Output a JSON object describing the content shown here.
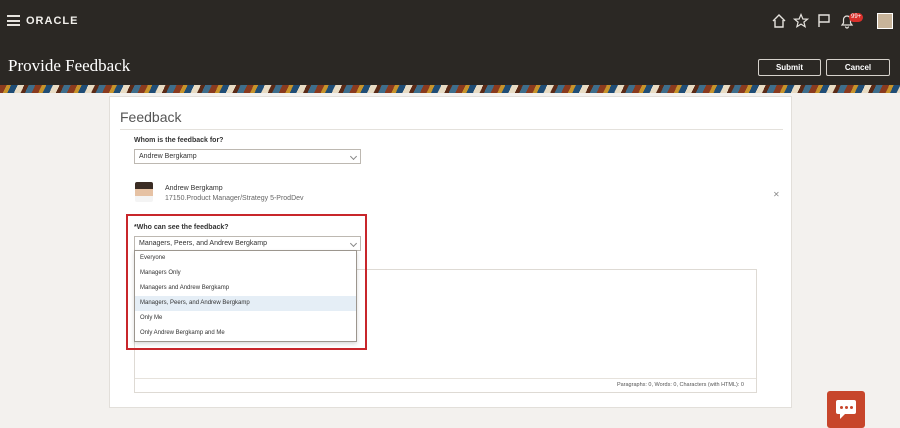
{
  "header": {
    "brand": "ORACLE",
    "notification_count": "99+",
    "icons": [
      "hamburger-menu-icon",
      "home-icon",
      "star-icon",
      "flag-icon",
      "bell-icon"
    ]
  },
  "page": {
    "title": "Provide Feedback",
    "submit_label": "Submit",
    "cancel_label": "Cancel"
  },
  "card": {
    "section_title": "Feedback",
    "whom_label": "Whom is the feedback for?",
    "whom_value": "Andrew Bergkamp",
    "person": {
      "name": "Andrew Bergkamp",
      "role": "17150.Product Manager/Strategy 5-ProdDev"
    },
    "visibility_label": "*Who can see the feedback?",
    "visibility_value": "Managers, Peers, and Andrew Bergkamp",
    "visibility_options": [
      "Everyone",
      "Managers Only",
      "Managers and Andrew Bergkamp",
      "Managers, Peers, and Andrew Bergkamp",
      "Only Me",
      "Only Andrew Bergkamp and Me"
    ],
    "selected_option_index": 3,
    "editor_stats": "Paragraphs: 0, Words: 0, Characters (with HTML): 0"
  },
  "colors": {
    "header_bg": "#2b2824",
    "highlight": "#c8262b",
    "chat_button": "#c7462b",
    "selected_option": "#e5eef6"
  }
}
